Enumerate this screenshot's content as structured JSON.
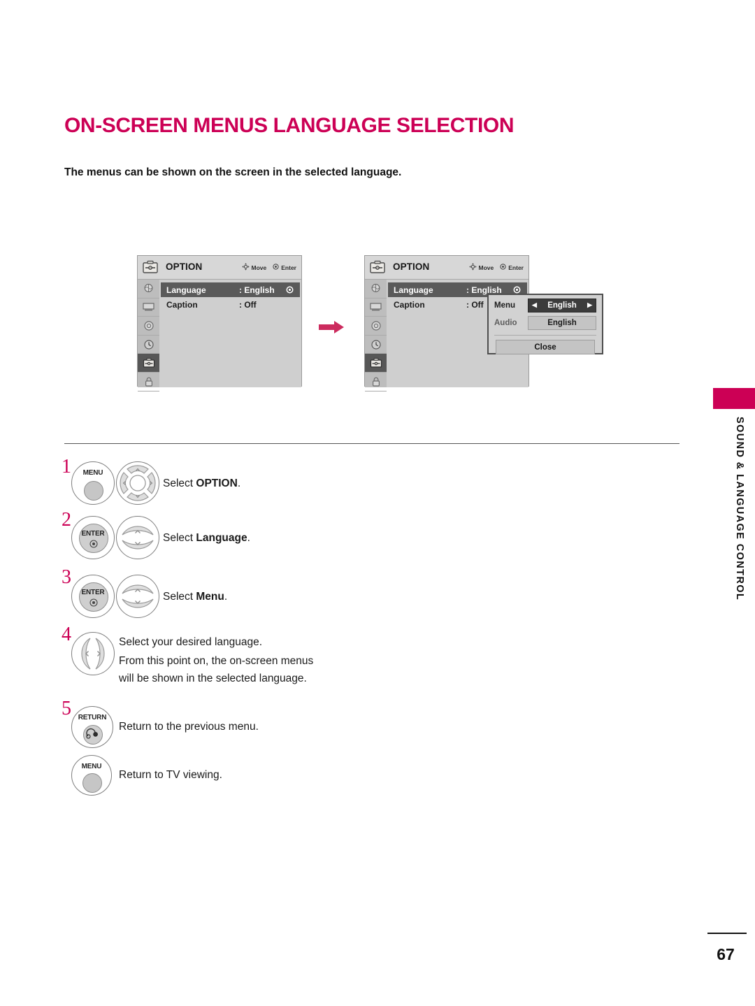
{
  "page": {
    "title": "ON-SCREEN MENUS LANGUAGE SELECTION",
    "subtitle": "The menus can be shown on the screen in the selected language.",
    "number": "67",
    "side_label": "SOUND & LANGUAGE CONTROL",
    "accent_color": "#cc0055"
  },
  "osd": {
    "title": "OPTION",
    "hints": {
      "move": "Move",
      "enter": "Enter"
    },
    "rows": [
      {
        "label": "Language",
        "value": ": English",
        "selected": true
      },
      {
        "label": "Caption",
        "value": ": Off",
        "selected": false
      }
    ],
    "rail_icons": [
      "picture-icon",
      "screen-icon",
      "audio-icon",
      "time-icon",
      "option-icon",
      "lock-icon"
    ],
    "rail_active_index": 4
  },
  "popup": {
    "menu_label": "Menu",
    "menu_value": "English",
    "audio_label": "Audio",
    "audio_value": "English",
    "close_label": "Close",
    "arrow_left": "◀",
    "arrow_right": "▶"
  },
  "steps": [
    {
      "num": "1",
      "button": "MENU",
      "pad": "dpad-4way",
      "text_html": "Select <b>OPTION</b>."
    },
    {
      "num": "2",
      "button": "ENTER",
      "pad": "updown",
      "text_html": "Select <b>Language</b>."
    },
    {
      "num": "3",
      "button": "ENTER",
      "pad": "updown",
      "text_html": "Select <b>Menu</b>."
    },
    {
      "num": "4",
      "button": "",
      "pad": "leftright",
      "text_lines": [
        "Select your desired language.",
        "From this point on, the on-screen menus",
        "will be shown in the selected language."
      ]
    },
    {
      "num": "5",
      "button": "RETURN",
      "pad": "",
      "text_html": "Return to the previous menu."
    },
    {
      "num": "",
      "button": "MENU",
      "pad": "",
      "text_html": "Return to TV viewing."
    }
  ]
}
